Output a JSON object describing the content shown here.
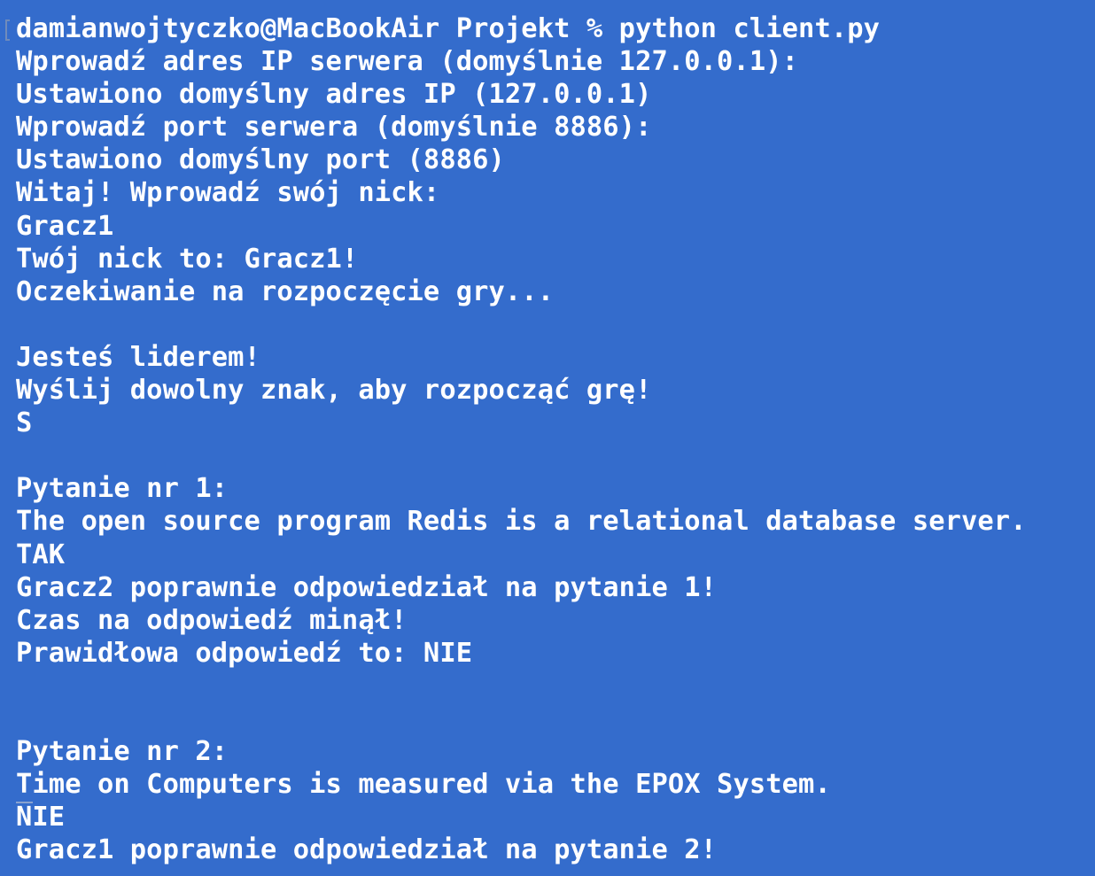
{
  "terminal": {
    "lines": [
      "damianwojtyczko@MacBookAir Projekt % python client.py",
      "Wprowadź adres IP serwera (domyślnie 127.0.0.1):",
      "Ustawiono domyślny adres IP (127.0.0.1)",
      "Wprowadź port serwera (domyślnie 8886):",
      "Ustawiono domyślny port (8886)",
      "Witaj! Wprowadź swój nick:",
      "Gracz1",
      "Twój nick to: Gracz1!",
      "Oczekiwanie na rozpoczęcie gry...",
      "",
      "Jesteś liderem!",
      "Wyślij dowolny znak, aby rozpocząć grę!",
      "S",
      "",
      "Pytanie nr 1:",
      "The open source program Redis is a relational database server.",
      "TAK",
      "Gracz2 poprawnie odpowiedział na pytanie 1!",
      "Czas na odpowiedź minął!",
      "Prawidłowa odpowiedź to: NIE",
      "",
      "",
      "Pytanie nr 2:",
      "Time on Computers is measured via the EPOX System.",
      "NIE",
      "Gracz1 poprawnie odpowiedział na pytanie 2!"
    ]
  },
  "colors": {
    "background": "#346ccc",
    "text": "#ffffff"
  }
}
